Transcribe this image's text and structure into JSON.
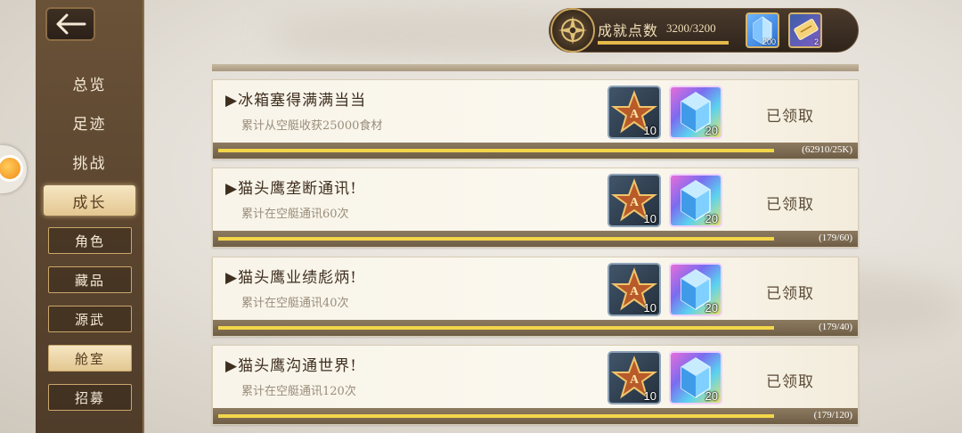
{
  "header": {
    "points_label": "成就点数",
    "points_value": "3200/3200",
    "points_progress": 1.0,
    "rewards": [
      {
        "icon": "blue-crystal-icon",
        "count": "200"
      },
      {
        "icon": "ticket-icon",
        "count": "2"
      }
    ]
  },
  "sidebar": {
    "main_items": [
      {
        "label": "总览",
        "active": false
      },
      {
        "label": "足迹",
        "active": false
      },
      {
        "label": "挑战",
        "active": false
      },
      {
        "label": "成长",
        "active": true
      }
    ],
    "sub_items": [
      {
        "label": "角色",
        "active": false
      },
      {
        "label": "藏品",
        "active": false
      },
      {
        "label": "源武",
        "active": false
      },
      {
        "label": "舱室",
        "active": true
      },
      {
        "label": "招募",
        "active": false
      }
    ]
  },
  "achievements": [
    {
      "title": "▶冰箱塞得满满当当",
      "description": "累计从空艇收获25000食材",
      "rewards": [
        {
          "icon": "star-medal-icon",
          "count": "10"
        },
        {
          "icon": "crystal-icon",
          "count": "20"
        }
      ],
      "status": "已领取",
      "progress_text": "(62910/25K)",
      "progress": 1.0
    },
    {
      "title": "▶猫头鹰垄断通讯!",
      "description": "累计在空艇通讯60次",
      "rewards": [
        {
          "icon": "star-medal-icon",
          "count": "10"
        },
        {
          "icon": "crystal-icon",
          "count": "20"
        }
      ],
      "status": "已领取",
      "progress_text": "(179/60)",
      "progress": 1.0
    },
    {
      "title": "▶猫头鹰业绩彪炳!",
      "description": "累计在空艇通讯40次",
      "rewards": [
        {
          "icon": "star-medal-icon",
          "count": "10"
        },
        {
          "icon": "crystal-icon",
          "count": "20"
        }
      ],
      "status": "已领取",
      "progress_text": "(179/40)",
      "progress": 1.0
    },
    {
      "title": "▶猫头鹰沟通世界!",
      "description": "累计在空艇通讯120次",
      "rewards": [
        {
          "icon": "star-medal-icon",
          "count": "10"
        },
        {
          "icon": "crystal-icon",
          "count": "20"
        }
      ],
      "status": "已领取",
      "progress_text": "(179/120)",
      "progress": 1.0
    }
  ],
  "colors": {
    "sidebar": "#5c4630",
    "active_tab": "#e3c791",
    "progress_fill": "#f3d54a"
  }
}
